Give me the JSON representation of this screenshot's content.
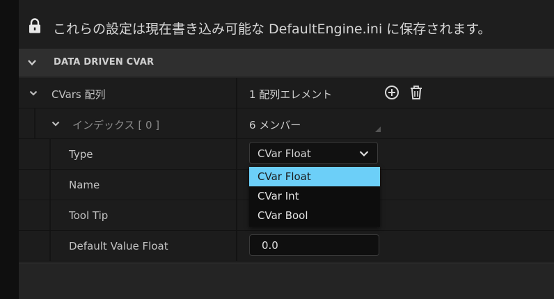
{
  "notice": {
    "text": "これらの設定は現在書き込み可能な DefaultEngine.ini に保存されます。",
    "icon": "lock-icon"
  },
  "section": {
    "title": "DATA DRIVEN CVAR"
  },
  "rows": {
    "cvars": {
      "label": "CVars 配列",
      "value": "1 配列エレメント"
    },
    "index": {
      "label": "インデックス [ 0 ]",
      "value": "6 メンバー"
    },
    "type": {
      "label": "Type",
      "value": "CVar Float"
    },
    "name": {
      "label": "Name"
    },
    "tooltip": {
      "label": "Tool Tip"
    },
    "default_value": {
      "label": "Default Value Float",
      "value": "0.0"
    }
  },
  "dropdown": {
    "options": [
      "CVar Float",
      "CVar Int",
      "CVar Bool"
    ],
    "selected": "CVar Float",
    "highlight_color": "#6ccff8"
  },
  "colors": {
    "panel_bg": "#242424",
    "row_bg": "#1c1c1c",
    "header_bg": "#2f2f2f"
  }
}
